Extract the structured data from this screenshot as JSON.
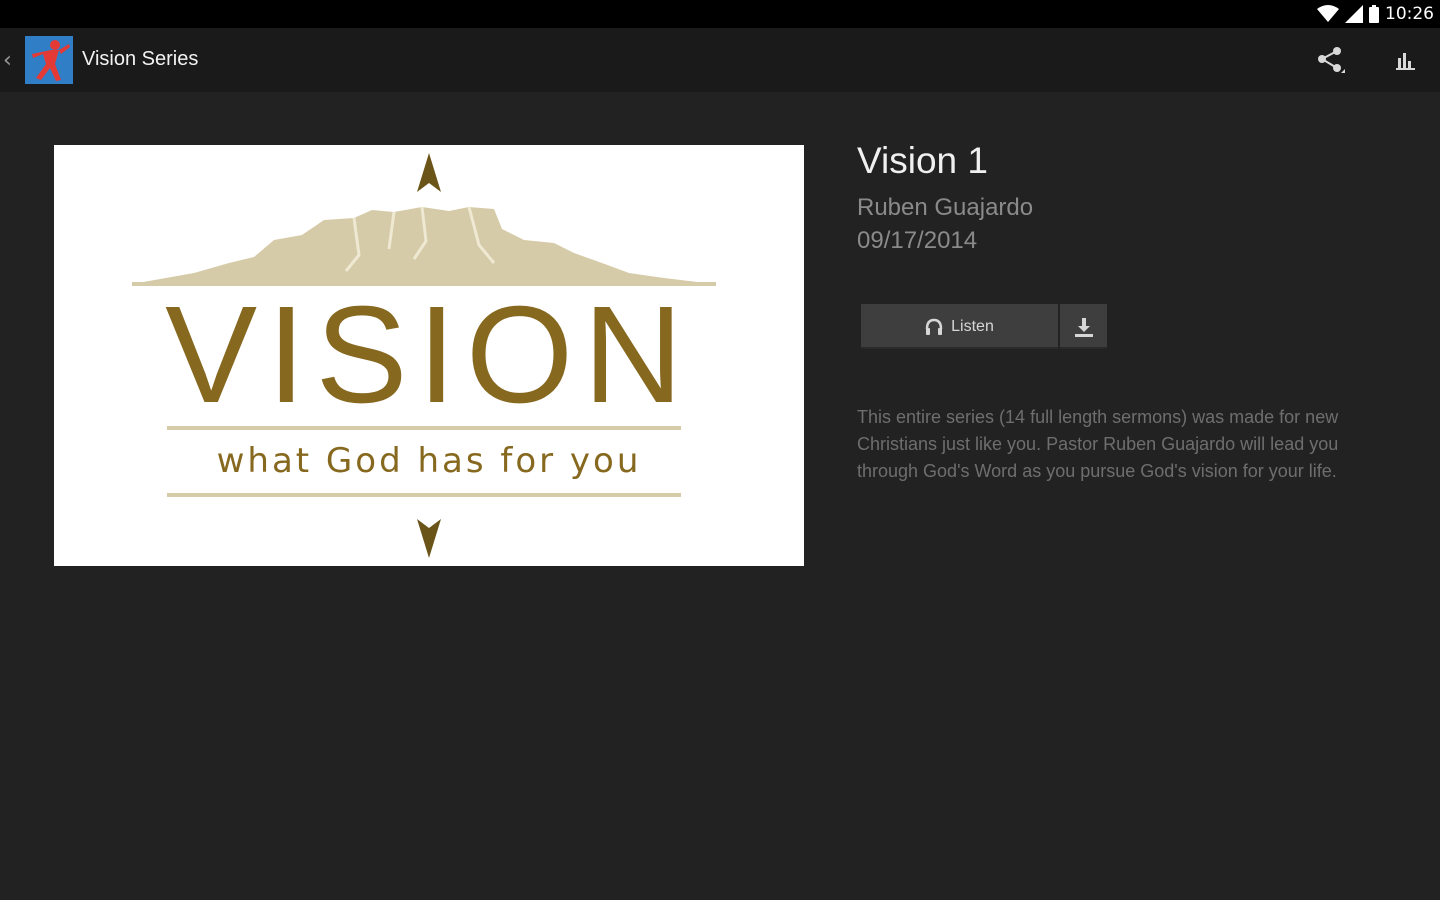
{
  "status_bar": {
    "time": "10:26",
    "icons": [
      "wifi-icon",
      "cell-signal-icon",
      "battery-icon"
    ]
  },
  "action_bar": {
    "up_icon": "chevron-left-icon",
    "title": "Vision Series",
    "actions": [
      "share-icon",
      "bar-chart-icon"
    ]
  },
  "artwork": {
    "headline": "VISION",
    "tagline": "what God has for you"
  },
  "sermon": {
    "title": "Vision 1",
    "speaker": "Ruben Guajardo",
    "date": "09/17/2014",
    "listen_label": "Listen",
    "description": "This entire series (14 full length sermons) was made for new Christians just like you.  Pastor Ruben Guajardo will lead you through God's Word as you pursue God's vision for your life."
  },
  "colors": {
    "background": "#222222",
    "action_bar": "#1a1a1a",
    "button": "#3e3e3e",
    "art_gold": "#86681f",
    "logo_blue": "#2f7ec6",
    "logo_red": "#e33a36"
  }
}
